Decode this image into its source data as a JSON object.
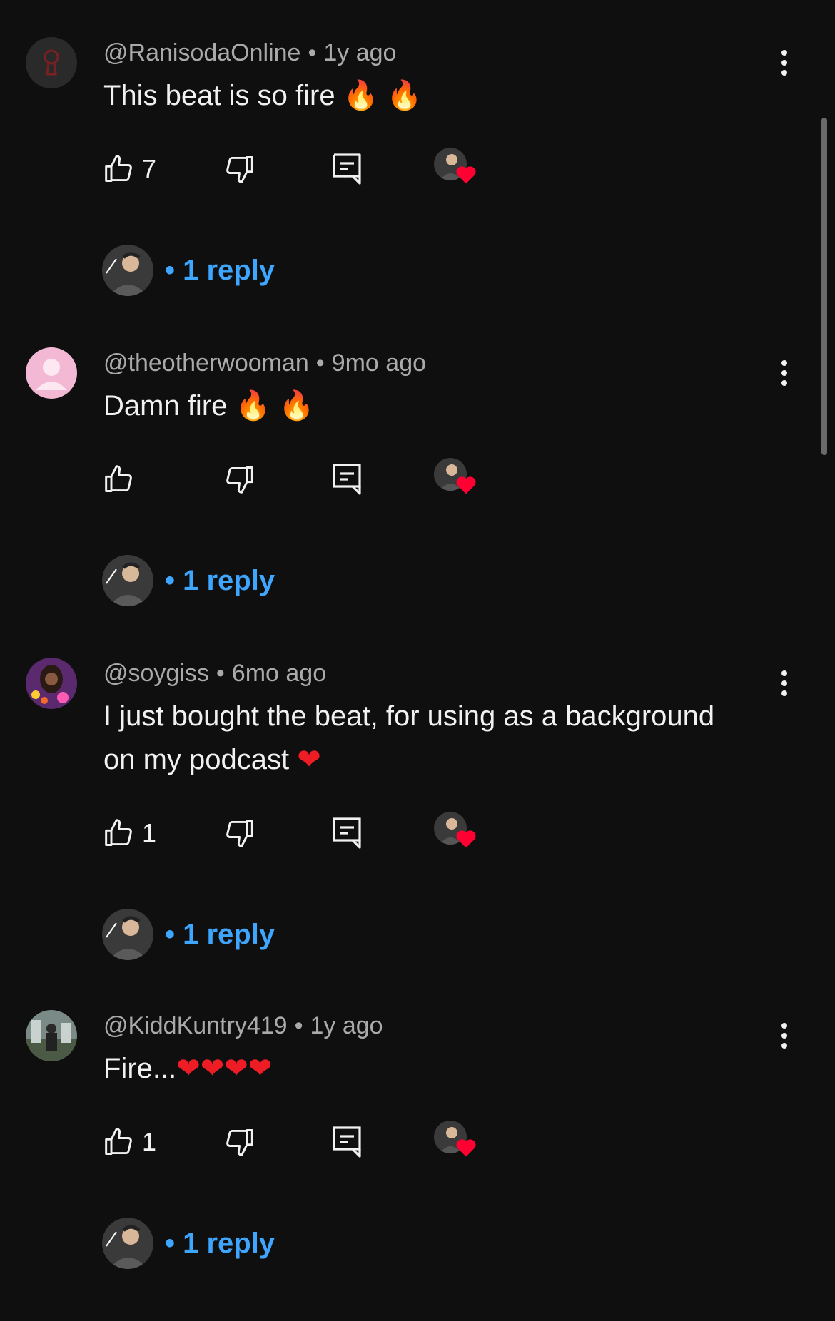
{
  "comments": [
    {
      "handle": "@RanisodaOnline",
      "separator": "•",
      "time": "1y ago",
      "text": "This beat is so fire",
      "emoji": [
        "🔥",
        "🔥"
      ],
      "emoji_kind": "fire",
      "like_count": "7",
      "replies_label": "• 1 reply",
      "avatar": "keyhole-logo-avatar"
    },
    {
      "handle": "@theotherwooman",
      "separator": "•",
      "time": "9mo ago",
      "text": "Damn fire",
      "emoji": [
        "🔥",
        "🔥"
      ],
      "emoji_kind": "fire",
      "like_count": "",
      "replies_label": "• 1 reply",
      "avatar": "default-pink-avatar"
    },
    {
      "handle": "@soygiss",
      "separator": "•",
      "time": "6mo ago",
      "text_line1": "I just bought the beat, for using as a background",
      "text_line2": "on my podcast",
      "emoji": [
        "❤"
      ],
      "emoji_kind": "heart",
      "like_count": "1",
      "replies_label": "• 1 reply",
      "avatar": "photo-avatar-woman"
    },
    {
      "handle": "@KiddKuntry419",
      "separator": "•",
      "time": "1y ago",
      "text": "Fire...",
      "emoji": [
        "❤",
        "❤",
        "❤",
        "❤"
      ],
      "emoji_kind": "heart",
      "like_count": "1",
      "replies_label": "• 1 reply",
      "avatar": "photo-avatar-outdoor"
    }
  ],
  "colors": {
    "background": "#0f0f0f",
    "meta_text": "#aaaaaa",
    "reply_link": "#3ea6ff",
    "heart_badge": "#ff0033"
  }
}
